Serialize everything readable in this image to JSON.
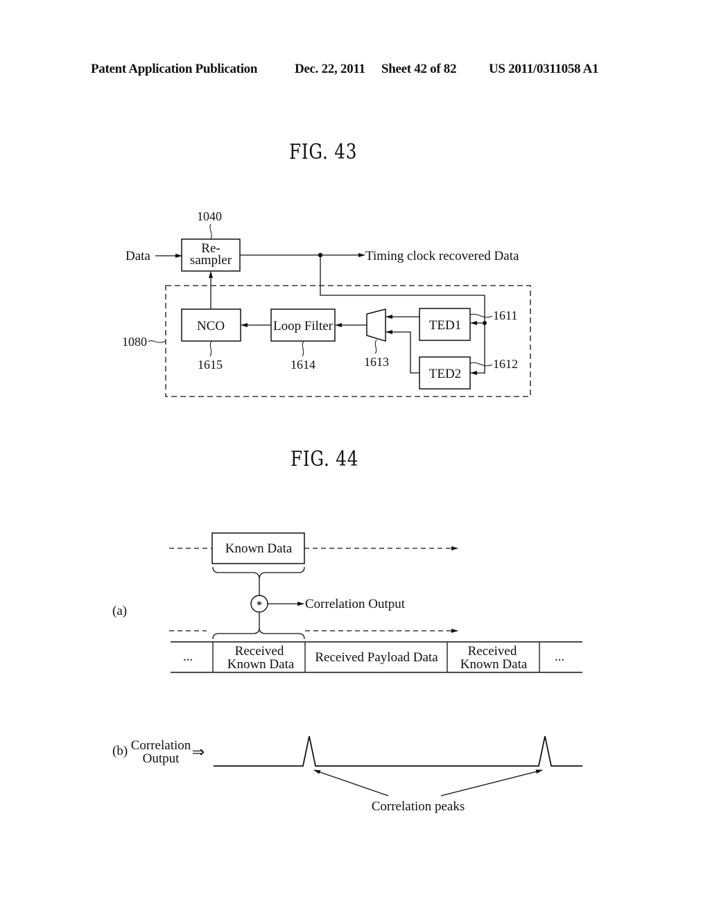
{
  "header": {
    "publication_type": "Patent Application Publication",
    "date": "Dec. 22, 2011",
    "sheet": "Sheet 42 of 82",
    "patent_number": "US 2011/0311058 A1"
  },
  "fig43": {
    "title": "FIG. 43",
    "input_label": "Data",
    "output_label": "Timing clock recovered Data",
    "resampler": {
      "label_line1": "Re-",
      "label_line2": "sampler",
      "ref": "1040"
    },
    "loop_ref": "1080",
    "nco": {
      "label": "NCO",
      "ref": "1615"
    },
    "loop_filter": {
      "label": "Loop Filter",
      "ref": "1614"
    },
    "mux": {
      "ref": "1613"
    },
    "ted1": {
      "label": "TED1",
      "ref": "1611"
    },
    "ted2": {
      "label": "TED2",
      "ref": "1612"
    }
  },
  "fig44": {
    "title": "FIG. 44",
    "part_a": {
      "label": "(a)",
      "known_data": "Known Data",
      "operator": "*",
      "correlation_output": "Correlation Output",
      "frame_cells": [
        {
          "line1": "...",
          "line2": ""
        },
        {
          "line1": "Received",
          "line2": "Known Data"
        },
        {
          "line1": "Received Payload Data",
          "line2": ""
        },
        {
          "line1": "Received",
          "line2": "Known Data"
        },
        {
          "line1": "...",
          "line2": ""
        }
      ]
    },
    "part_b": {
      "label": "(b)",
      "signal_label_line1": "Correlation",
      "signal_label_line2": "Output",
      "arrow_symbol": "⇒",
      "peaks_label": "Correlation peaks"
    }
  }
}
